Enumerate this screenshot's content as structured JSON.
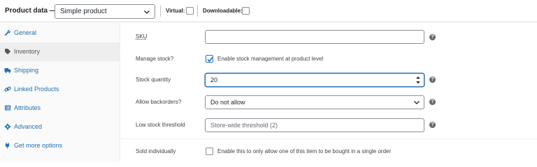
{
  "header": {
    "title": "Product data —",
    "product_type": "Simple product",
    "virtual_label": "Virtual:",
    "downloadable_label": "Downloadable:"
  },
  "sidebar": {
    "items": [
      {
        "label": "General",
        "icon": "wrench-icon",
        "active": false
      },
      {
        "label": "Inventory",
        "icon": "tag-icon",
        "active": true
      },
      {
        "label": "Shipping",
        "icon": "truck-icon",
        "active": false
      },
      {
        "label": "Linked Products",
        "icon": "link-icon",
        "active": false
      },
      {
        "label": "Attributes",
        "icon": "list-icon",
        "active": false
      },
      {
        "label": "Advanced",
        "icon": "gear-icon",
        "active": false
      },
      {
        "label": "Get more options",
        "icon": "plugin-icon",
        "active": false
      }
    ]
  },
  "fields": {
    "sku": {
      "label": "SKU",
      "value": ""
    },
    "manage_stock": {
      "label": "Manage stock?",
      "checkbox_text": "Enable stock management at product level",
      "checked": true
    },
    "stock_quantity": {
      "label": "Stock quantity",
      "value": "20"
    },
    "backorders": {
      "label": "Allow backorders?",
      "value": "Do not allow"
    },
    "low_stock": {
      "label": "Low stock threshold",
      "placeholder": "Store-wide threshold (2)"
    },
    "sold_individually": {
      "label": "Sold individually",
      "checkbox_text": "Enable this to only allow one of this item to be bought in a single order",
      "checked": false
    }
  },
  "colors": {
    "accent": "#2271b1",
    "help_icon": "#646970"
  }
}
